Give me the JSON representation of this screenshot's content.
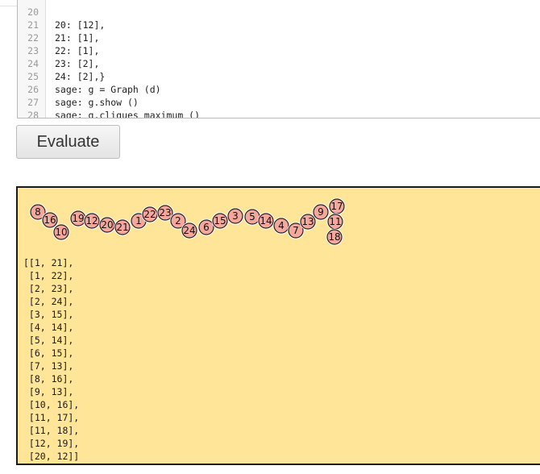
{
  "editor": {
    "lines": [
      {
        "num": "20",
        "code": "20: [12],"
      },
      {
        "num": "21",
        "code": "21: [1],"
      },
      {
        "num": "22",
        "code": "22: [1],"
      },
      {
        "num": "23",
        "code": "23: [2],"
      },
      {
        "num": "24",
        "code": "24: [2],}"
      },
      {
        "num": "25",
        "code": "sage: g = Graph (d)"
      },
      {
        "num": "26",
        "code": "sage: g.show ()"
      },
      {
        "num": "27",
        "code": "sage: g.cliques_maximum ()"
      },
      {
        "num": "28",
        "code": ""
      }
    ]
  },
  "evaluate_button": {
    "label": "Evaluate"
  },
  "output": {
    "graph_vertices": [
      "8",
      "16",
      "10",
      "19",
      "12",
      "20",
      "21",
      "1",
      "22",
      "23",
      "2",
      "24",
      "6",
      "15",
      "3",
      "5",
      "14",
      "4",
      "7",
      "13",
      "9",
      "17",
      "11",
      "18"
    ],
    "result_text": "[[1, 21],\n [1, 22],\n [2, 23],\n [2, 24],\n [3, 15],\n [4, 14],\n [5, 14],\n [6, 15],\n [7, 13],\n [8, 16],\n [9, 13],\n [10, 16],\n [11, 17],\n [11, 18],\n [12, 19],\n [20, 12]]"
  },
  "colors": {
    "output_background": "#ffe598",
    "vertex_fill": "#f4a79a",
    "vertex_stroke": "#222222"
  }
}
